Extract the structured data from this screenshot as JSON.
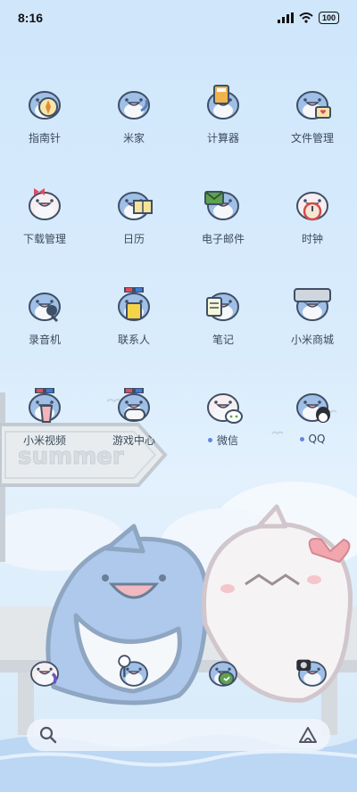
{
  "status_bar": {
    "time": "8:16",
    "battery": "100"
  },
  "apps": [
    {
      "label": "指南针",
      "icon": "compass-icon",
      "dot": false,
      "prop": "compass"
    },
    {
      "label": "米家",
      "icon": "mijia-icon",
      "dot": false,
      "prop": "wrench"
    },
    {
      "label": "计算器",
      "icon": "calculator-icon",
      "dot": false,
      "prop": "calc"
    },
    {
      "label": "文件管理",
      "icon": "file-manager-icon",
      "dot": false,
      "prop": "heartcard"
    },
    {
      "label": "下载管理",
      "icon": "download-manager-icon",
      "dot": false,
      "prop": "pinkbow"
    },
    {
      "label": "日历",
      "icon": "calendar-icon",
      "dot": false,
      "prop": "book"
    },
    {
      "label": "电子邮件",
      "icon": "email-icon",
      "dot": false,
      "prop": "envelope"
    },
    {
      "label": "时钟",
      "icon": "clock-icon",
      "dot": false,
      "prop": "clock"
    },
    {
      "label": "录音机",
      "icon": "recorder-icon",
      "dot": false,
      "prop": "mic"
    },
    {
      "label": "联系人",
      "icon": "contacts-icon",
      "dot": false,
      "prop": "card"
    },
    {
      "label": "笔记",
      "icon": "notes-icon",
      "dot": false,
      "prop": "note"
    },
    {
      "label": "小米商城",
      "icon": "mi-store-icon",
      "dot": false,
      "prop": "bag"
    },
    {
      "label": "小米视频",
      "icon": "mi-video-icon",
      "dot": false,
      "prop": "popcorn"
    },
    {
      "label": "游戏中心",
      "icon": "game-center-icon",
      "dot": false,
      "prop": "gamepad"
    },
    {
      "label": "微信",
      "icon": "wechat-icon",
      "dot": true,
      "prop": "wechat"
    },
    {
      "label": "QQ",
      "icon": "qq-icon",
      "dot": true,
      "prop": "penguin"
    }
  ],
  "wallpaper": {
    "sign_text": "summer"
  },
  "dock": [
    {
      "icon": "phone-icon",
      "prop": "phone"
    },
    {
      "icon": "browser-icon",
      "prop": "magnifier"
    },
    {
      "icon": "messages-icon",
      "prop": "chat"
    },
    {
      "icon": "camera-icon",
      "prop": "camera"
    }
  ],
  "colors": {
    "shark_blue": "#9fbfe6",
    "shark_outline": "#3f4f66",
    "accent_dot": "#5e86e2",
    "label_text": "#3b4a5c"
  }
}
